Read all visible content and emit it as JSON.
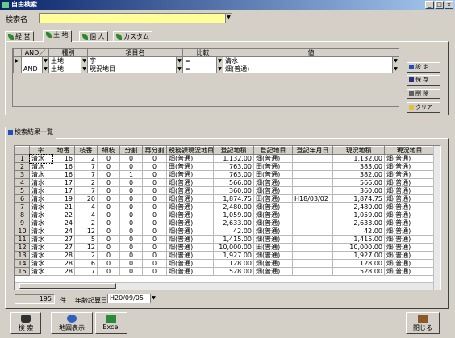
{
  "window": {
    "title": "自由検索",
    "min": "_",
    "max": "□",
    "close": "×"
  },
  "search_name": {
    "label": "検索名",
    "value": ""
  },
  "tabs": [
    {
      "label": "経 営"
    },
    {
      "label": "土 地"
    },
    {
      "label": "個 人"
    },
    {
      "label": "カスタム"
    }
  ],
  "conditions": {
    "headers": [
      "AND／",
      "種別",
      "項目名",
      "比較",
      "値"
    ],
    "rows": [
      {
        "and": "",
        "type": "土地",
        "item": "字",
        "cmp": "=",
        "value": "清水"
      },
      {
        "and": "AND",
        "type": "土地",
        "item": "現況地目",
        "cmp": "=",
        "value": "畑(普通)"
      }
    ]
  },
  "side_buttons": [
    "設 定",
    "保 存",
    "削 除",
    "クリア"
  ],
  "results_tab": {
    "label": "検索結果一覧"
  },
  "results": {
    "headers": [
      "",
      "字",
      "地番",
      "枝番",
      "細枝",
      "分割",
      "再分割",
      "税務課現況地目",
      "登記地積",
      "登記地目",
      "登記年月日",
      "現況地積",
      "現況地目"
    ],
    "rows": [
      [
        "1",
        "清水",
        "16",
        "2",
        "0",
        "0",
        "0",
        "畑(普通)",
        "1,132.00",
        "畑(普通)",
        "",
        "1,132.00",
        "畑(普通)"
      ],
      [
        "2",
        "清水",
        "16",
        "7",
        "0",
        "0",
        "0",
        "田(普通)",
        "763.00",
        "田(普通)",
        "",
        "383.00",
        "畑(普通)"
      ],
      [
        "3",
        "清水",
        "16",
        "7",
        "0",
        "1",
        "0",
        "畑(普通)",
        "763.00",
        "田(普通)",
        "",
        "382.00",
        "畑(普通)"
      ],
      [
        "4",
        "清水",
        "17",
        "2",
        "0",
        "0",
        "0",
        "畑(普通)",
        "566.00",
        "畑(普通)",
        "",
        "566.00",
        "畑(普通)"
      ],
      [
        "5",
        "清水",
        "17",
        "7",
        "0",
        "0",
        "0",
        "畑(普通)",
        "360.00",
        "畑(普通)",
        "",
        "360.00",
        "畑(普通)"
      ],
      [
        "6",
        "清水",
        "19",
        "20",
        "0",
        "0",
        "0",
        "畑(普通)",
        "1,874.75",
        "田(普通)",
        "H18/03/02",
        "1,874.75",
        "畑(普通)"
      ],
      [
        "7",
        "清水",
        "21",
        "4",
        "0",
        "0",
        "0",
        "畑(普通)",
        "2,480.00",
        "畑(普通)",
        "",
        "2,480.00",
        "畑(普通)"
      ],
      [
        "8",
        "清水",
        "22",
        "4",
        "0",
        "0",
        "0",
        "畑(普通)",
        "1,059.00",
        "畑(普通)",
        "",
        "1,059.00",
        "畑(普通)"
      ],
      [
        "9",
        "清水",
        "24",
        "2",
        "0",
        "0",
        "0",
        "畑(普通)",
        "2,633.00",
        "畑(普通)",
        "",
        "2,633.00",
        "畑(普通)"
      ],
      [
        "10",
        "清水",
        "24",
        "12",
        "0",
        "0",
        "0",
        "畑(普通)",
        "42.00",
        "畑(普通)",
        "",
        "42.00",
        "畑(普通)"
      ],
      [
        "11",
        "清水",
        "27",
        "5",
        "0",
        "0",
        "0",
        "畑(普通)",
        "1,415.00",
        "畑(普通)",
        "",
        "1,415.00",
        "畑(普通)"
      ],
      [
        "12",
        "清水",
        "27",
        "12",
        "0",
        "0",
        "0",
        "畑(普通)",
        "10,000.00",
        "田(普通)",
        "",
        "10,000.00",
        "畑(普通)"
      ],
      [
        "13",
        "清水",
        "28",
        "2",
        "0",
        "0",
        "0",
        "畑(普通)",
        "1,927.00",
        "畑(普通)",
        "",
        "1,927.00",
        "畑(普通)"
      ],
      [
        "14",
        "清水",
        "28",
        "6",
        "0",
        "0",
        "0",
        "畑(普通)",
        "128.00",
        "畑(普通)",
        "",
        "128.00",
        "畑(普通)"
      ],
      [
        "15",
        "清水",
        "28",
        "7",
        "0",
        "0",
        "0",
        "畑(普通)",
        "528.00",
        "畑(普通)",
        "",
        "528.00",
        "畑(普通)"
      ]
    ]
  },
  "status": {
    "count": "195",
    "count_unit": "件",
    "date_label": "年齢起算日",
    "date_value": "H20/09/05"
  },
  "bottom_buttons": {
    "search": "検 索",
    "map": "地図表示",
    "excel": "Excel",
    "close": "閉じる"
  }
}
